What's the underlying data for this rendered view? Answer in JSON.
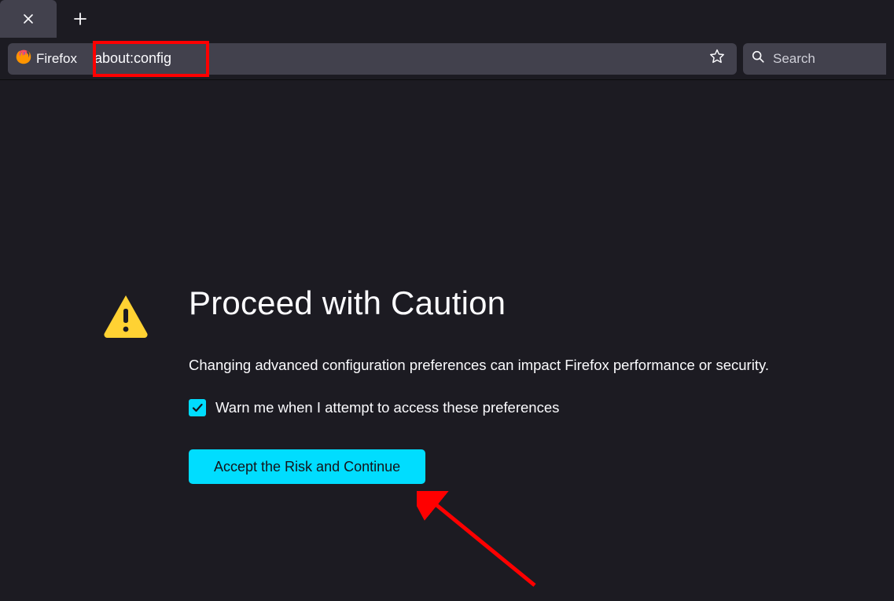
{
  "toolbar": {
    "identity_label": "Firefox",
    "url": "about:config",
    "search_placeholder": "Search"
  },
  "page": {
    "heading": "Proceed with Caution",
    "description": "Changing advanced configuration preferences can impact Firefox performance or security.",
    "checkbox_label": "Warn me when I attempt to access these preferences",
    "checkbox_checked": true,
    "accept_button": "Accept the Risk and Continue"
  },
  "annotation": {
    "highlight_target": "url-bar",
    "arrow_target": "accept-button"
  }
}
